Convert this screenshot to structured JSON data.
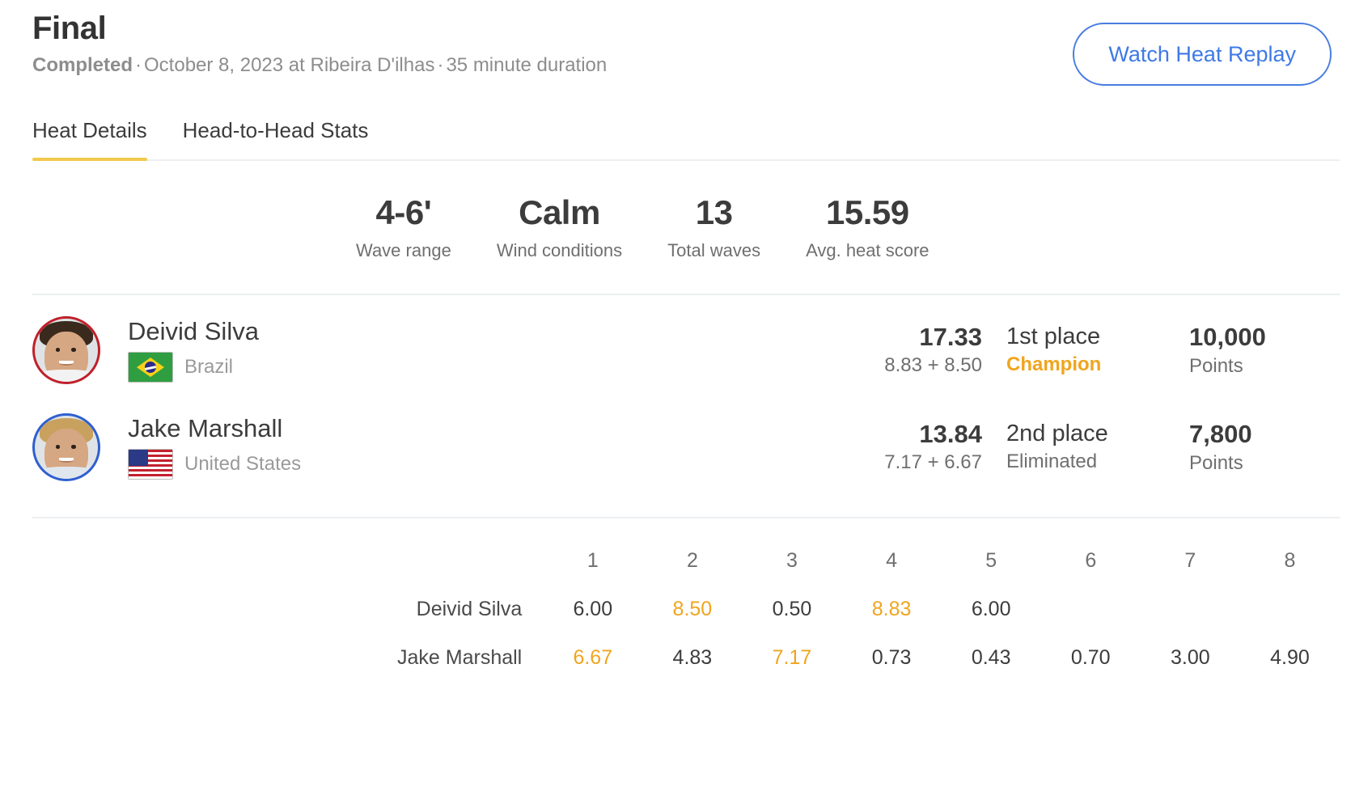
{
  "header": {
    "title": "Final",
    "status": "Completed",
    "separator": "·",
    "date": "October 8, 2023 at Ribeira D'ilhas",
    "duration": "35 minute duration",
    "replay_button": "Watch Heat Replay"
  },
  "tabs": [
    {
      "label": "Heat Details",
      "active": true
    },
    {
      "label": "Head-to-Head Stats",
      "active": false
    }
  ],
  "stats": [
    {
      "value": "4-6'",
      "label": "Wave range"
    },
    {
      "value": "Calm",
      "label": "Wind conditions"
    },
    {
      "value": "13",
      "label": "Total waves"
    },
    {
      "value": "15.59",
      "label": "Avg. heat score"
    }
  ],
  "surfers": [
    {
      "name": "Deivid Silva",
      "country": "Brazil",
      "flag": "br",
      "rank_ring": "rank1",
      "total": "17.33",
      "breakdown": "8.83 + 8.50",
      "place": "1st place",
      "status": "Champion",
      "status_highlight": true,
      "points": "10,000",
      "points_label": "Points"
    },
    {
      "name": "Jake Marshall",
      "country": "United States",
      "flag": "us",
      "rank_ring": "rank2",
      "total": "13.84",
      "breakdown": "7.17 + 6.67",
      "place": "2nd place",
      "status": "Eliminated",
      "status_highlight": false,
      "points": "7,800",
      "points_label": "Points"
    }
  ],
  "wave_table": {
    "columns": [
      "1",
      "2",
      "3",
      "4",
      "5",
      "6",
      "7",
      "8"
    ],
    "rows": [
      {
        "name": "Deivid Silva",
        "scores": [
          "6.00",
          "8.50",
          "0.50",
          "8.83",
          "6.00",
          "",
          "",
          ""
        ],
        "best": [
          false,
          true,
          false,
          true,
          false,
          false,
          false,
          false
        ]
      },
      {
        "name": "Jake Marshall",
        "scores": [
          "6.67",
          "4.83",
          "7.17",
          "0.73",
          "0.43",
          "0.70",
          "3.00",
          "4.90"
        ],
        "best": [
          true,
          false,
          true,
          false,
          false,
          false,
          false,
          false
        ]
      }
    ]
  },
  "colors": {
    "accent_gold": "#f0a51e",
    "tab_underline": "#f2c94c",
    "link_blue": "#3f7ae5",
    "rank1_ring": "#c0202a",
    "rank2_ring": "#2f5fd0"
  }
}
